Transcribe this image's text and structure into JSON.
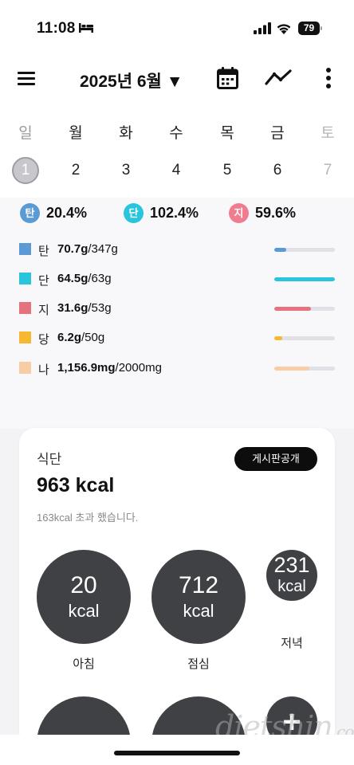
{
  "status": {
    "time": "11:08",
    "battery": "79"
  },
  "header": {
    "month_label": "2025년 6월 ▼"
  },
  "week": {
    "days": [
      {
        "name": "일",
        "num": "1"
      },
      {
        "name": "월",
        "num": "2"
      },
      {
        "name": "화",
        "num": "3"
      },
      {
        "name": "수",
        "num": "4"
      },
      {
        "name": "목",
        "num": "5"
      },
      {
        "name": "금",
        "num": "6"
      },
      {
        "name": "토",
        "num": "7"
      }
    ],
    "selected_index": 0
  },
  "ratios": [
    {
      "letter": "탄",
      "value": "20.4%",
      "color": "#5b9bd5"
    },
    {
      "letter": "단",
      "value": "102.4%",
      "color": "#29c5dc"
    },
    {
      "letter": "지",
      "value": "59.6%",
      "color": "#ef7c8f"
    }
  ],
  "nutrients": [
    {
      "label": "탄",
      "amount": "70.7g",
      "target": "/347g",
      "color": "#5b9bd5",
      "progress": 0.2
    },
    {
      "label": "단",
      "amount": "64.5g",
      "target": "/63g",
      "color": "#29c5dc",
      "progress": 1.0
    },
    {
      "label": "지",
      "amount": "31.6g",
      "target": "/53g",
      "color": "#e5737f",
      "progress": 0.6
    },
    {
      "label": "당",
      "amount": "6.2g",
      "target": "/50g",
      "color": "#f5b82e",
      "progress": 0.13
    },
    {
      "label": "나",
      "amount": "1,156.9mg",
      "target": "/2000mg",
      "color": "#f8cda5",
      "progress": 0.58
    }
  ],
  "diet": {
    "label": "식단",
    "share_label": "게시판공개",
    "total": "963 kcal",
    "over_text": "163kcal 초과 했습니다.",
    "meals": [
      {
        "name": "아침",
        "value": "20",
        "unit": "kcal"
      },
      {
        "name": "점심",
        "value": "712",
        "unit": "kcal"
      },
      {
        "name": "저녁",
        "value": "231",
        "unit": "kcal"
      }
    ],
    "add_symbol": "+"
  },
  "watermark": {
    "main": "dietshin",
    "tld": ".com"
  }
}
